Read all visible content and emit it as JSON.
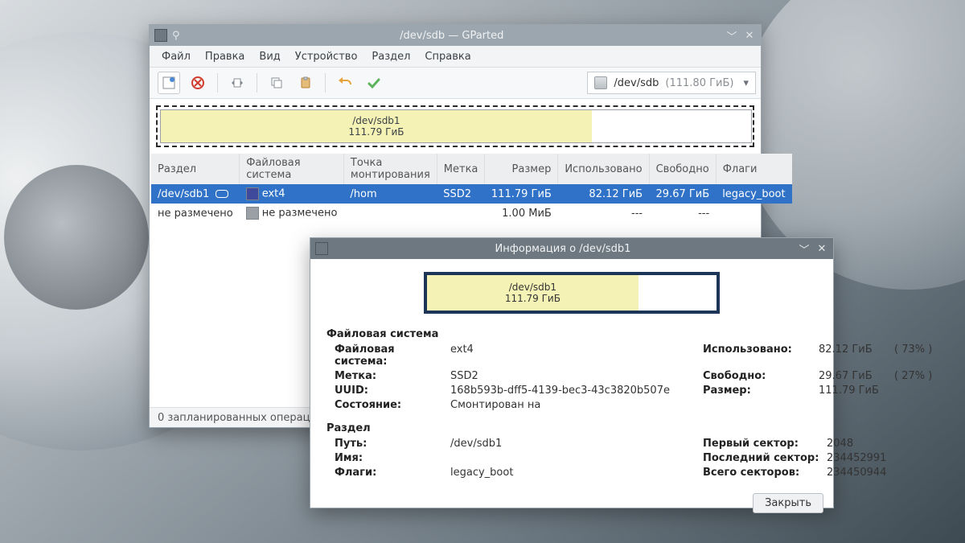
{
  "main": {
    "title": "/dev/sdb — GParted",
    "menu": [
      "Файл",
      "Правка",
      "Вид",
      "Устройство",
      "Раздел",
      "Справка"
    ],
    "device_selector": {
      "name": "/dev/sdb",
      "size": "(111.80 ГиБ)"
    },
    "map": {
      "label_top": "/dev/sdb1",
      "label_bottom": "111.79 ГиБ",
      "used_pct": 73
    },
    "columns": [
      "Раздел",
      "Файловая система",
      "Точка монтирования",
      "Метка",
      "Размер",
      "Использовано",
      "Свободно",
      "Флаги"
    ],
    "rows": [
      {
        "part": "/dev/sdb1",
        "fs": "ext4",
        "mount": "/hom",
        "label": "SSD2",
        "size": "111.79 ГиБ",
        "used": "82.12 ГиБ",
        "free": "29.67 ГиБ",
        "flags": "legacy_boot",
        "sel": true,
        "swatch": "sw-ext4",
        "key": true
      },
      {
        "part": "не размечено",
        "fs": "не размечено",
        "mount": "",
        "label": "",
        "size": "1.00 МиБ",
        "used": "---",
        "free": "---",
        "flags": "",
        "sel": false,
        "swatch": "sw-unalloc",
        "key": false
      }
    ],
    "status": "0 запланированных операций"
  },
  "dialog": {
    "title": "Информация о /dev/sdb1",
    "map": {
      "label_top": "/dev/sdb1",
      "label_bottom": "111.79 ГиБ",
      "used_pct": 73
    },
    "fs_header": "Файловая система",
    "fs": {
      "Файловая система:": "ext4",
      "Метка:": "SSD2",
      "UUID:": "168b593b-dff5-4139-bec3-43c3820b507e",
      "Состояние:": "Смонтирован на"
    },
    "usage": {
      "Использовано:": {
        "v": "82.12 ГиБ",
        "p": "( 73% )"
      },
      "Свободно:": {
        "v": "29.67 ГиБ",
        "p": "( 27% )"
      },
      "Размер:": {
        "v": "111.79 ГиБ",
        "p": ""
      }
    },
    "part_header": "Раздел",
    "part": {
      "Путь:": "/dev/sdb1",
      "Имя:": "",
      "Флаги:": "legacy_boot"
    },
    "sectors": {
      "Первый сектор:": "2048",
      "Последний сектор:": "234452991",
      "Всего секторов:": "234450944"
    },
    "close": "Закрыть"
  }
}
